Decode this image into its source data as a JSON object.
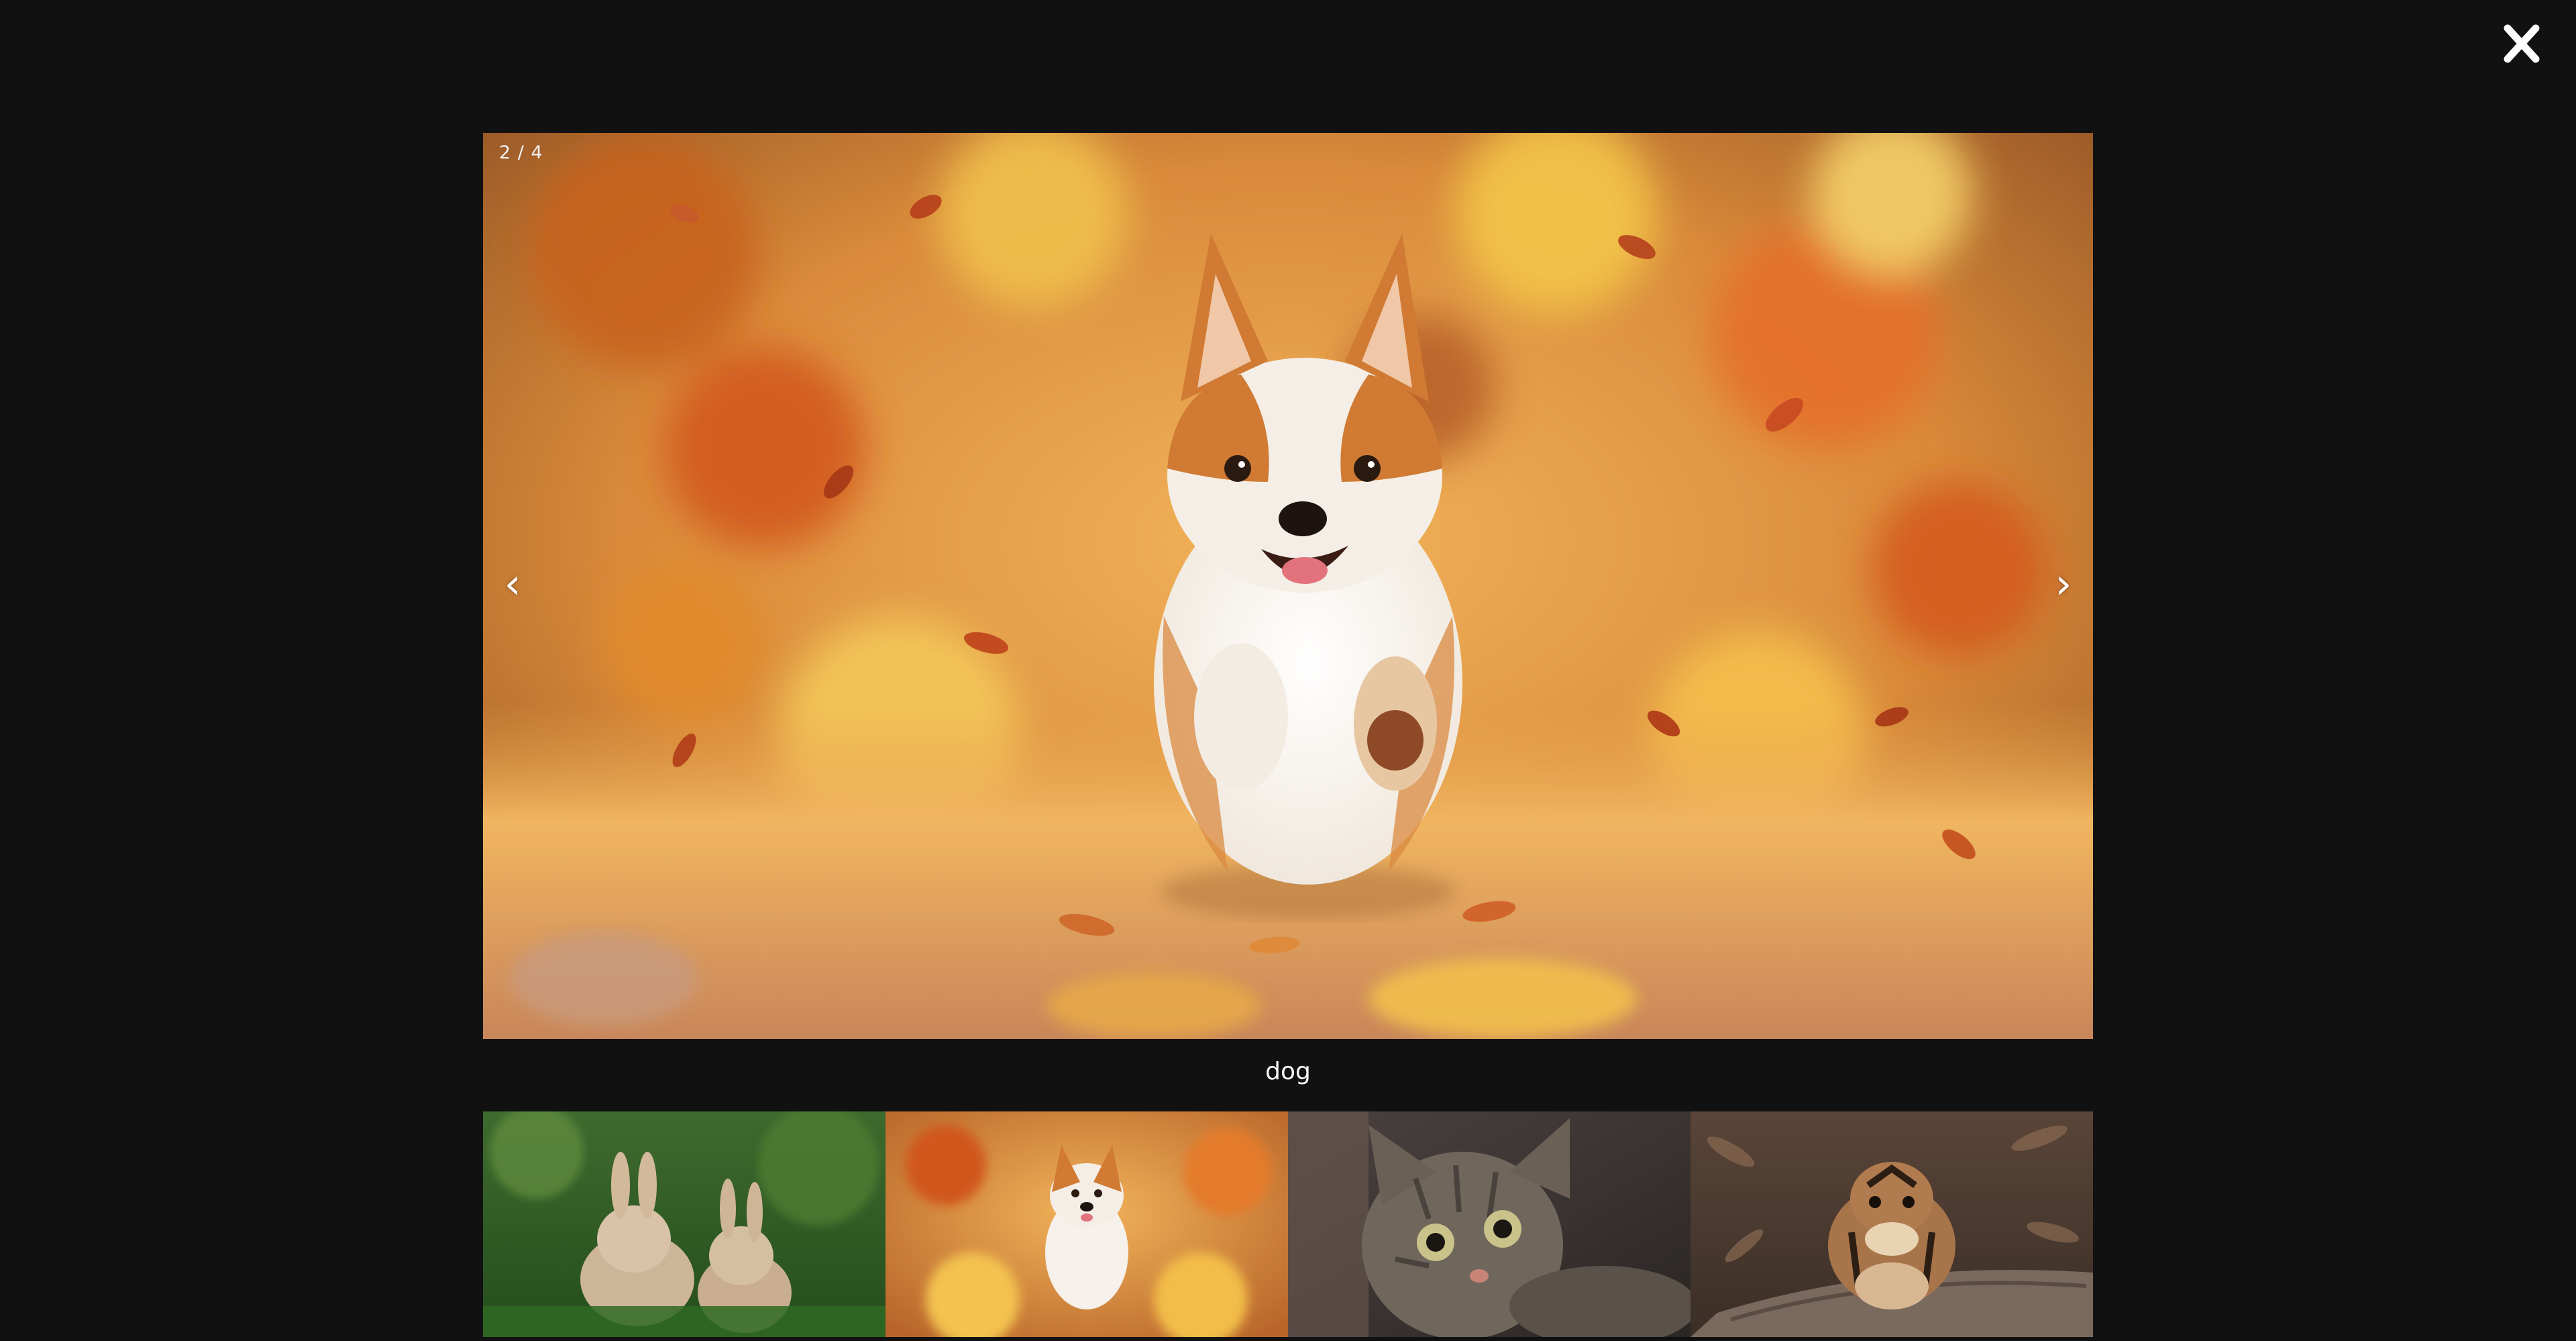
{
  "lightbox": {
    "counter": "2 / 4",
    "caption": "dog",
    "prev_glyph": "‹",
    "next_glyph": "›",
    "close_icon": "close-icon",
    "current_index": 2,
    "total": 4
  },
  "thumbnails": [
    {
      "subject": "rabbits",
      "selected": false
    },
    {
      "subject": "dog",
      "selected": true
    },
    {
      "subject": "cat",
      "selected": false
    },
    {
      "subject": "chipmunk",
      "selected": false
    }
  ],
  "colors": {
    "background": "#111112",
    "text": "#f5f5f5"
  }
}
